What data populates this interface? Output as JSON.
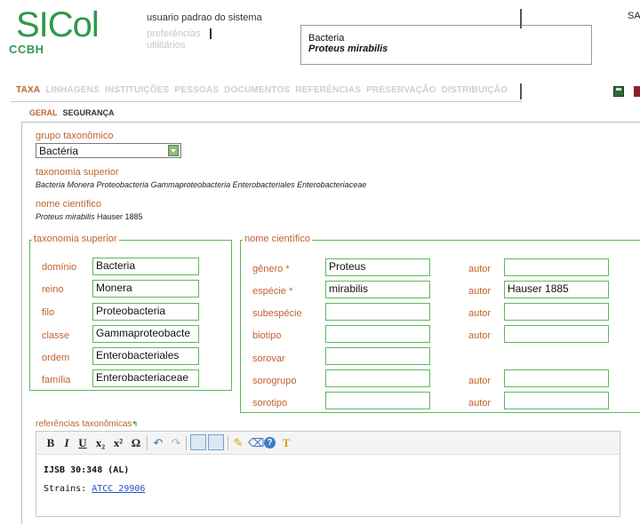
{
  "logo": {
    "main": "SICol",
    "sub": "CCBH"
  },
  "user": {
    "name": "usuario padrao do sistema",
    "preferences": "preferências",
    "utilities": "utilitários"
  },
  "top_right": "SA",
  "taxon": {
    "group": "Bacteria",
    "name": "Proteus mirabilis"
  },
  "tabs": [
    {
      "label": "TAXA"
    },
    {
      "label": "LINHAGENS"
    },
    {
      "label": "INSTITUIÇÕES"
    },
    {
      "label": "PESSOAS"
    },
    {
      "label": "DOCUMENTOS"
    },
    {
      "label": "REFERÊNCIAS"
    },
    {
      "label": "PRESERVAÇÃO"
    },
    {
      "label": "DISTRIBUIÇÃO"
    }
  ],
  "active_tab": "TAXA",
  "subtabs": [
    {
      "label": "GERAL"
    },
    {
      "label": "SEGURANÇA"
    }
  ],
  "form": {
    "group_label": "grupo taxonômico",
    "group_value": "Bactéria",
    "superior_label": "taxonomia superior",
    "superior_value": "Bacteria Monera Proteobacteria Gammaproteobacteria Enterobacteriales Enterobacteriaceae",
    "sci_label": "nome científico",
    "sci_value_italic": "Proteus mirabilis",
    "sci_value_author": " Hauser 1885"
  },
  "taxonomy_superior": {
    "legend": "taxonomia superior",
    "fields": [
      {
        "label": "domínio",
        "value": "Bacteria"
      },
      {
        "label": "reino",
        "value": "Monera"
      },
      {
        "label": "filo",
        "value": "Proteobacteria"
      },
      {
        "label": "classe",
        "value": "Gammaproteobacte"
      },
      {
        "label": "ordem",
        "value": "Enterobacteriales"
      },
      {
        "label": "família",
        "value": "Enterobacteriaceae"
      }
    ]
  },
  "scientific_name": {
    "legend": "nome científico",
    "author_label": "autor",
    "fields": [
      {
        "label": "gênero *",
        "value": "Proteus",
        "author": ""
      },
      {
        "label": "espécie *",
        "value": "mirabilis",
        "author": "Hauser 1885"
      },
      {
        "label": "subespécie",
        "value": "",
        "author": ""
      },
      {
        "label": "biotipo",
        "value": "",
        "author": ""
      },
      {
        "label": "sorovar",
        "value": ""
      },
      {
        "label": "sorogrupo",
        "value": "",
        "author": ""
      },
      {
        "label": "sorotipo",
        "value": "",
        "author": ""
      }
    ]
  },
  "references": {
    "label": "referências taxonômicas",
    "line1": "IJSB 30:348 (AL)",
    "line2_prefix": "Strains: ",
    "line2_link": "ATCC 29906"
  },
  "toolbar": {
    "bold": "B",
    "italic": "I",
    "underline": "U",
    "subscript": "x₂",
    "superscript": "x²",
    "omega": "Ω",
    "undo": "↶",
    "redo": "↷",
    "brush": "✎",
    "eraser": "⌫",
    "help": "?",
    "special": "T"
  },
  "colors": {
    "accent": "#c0622f",
    "brand": "#2e9a4a",
    "field_border": "#5cb85c"
  }
}
